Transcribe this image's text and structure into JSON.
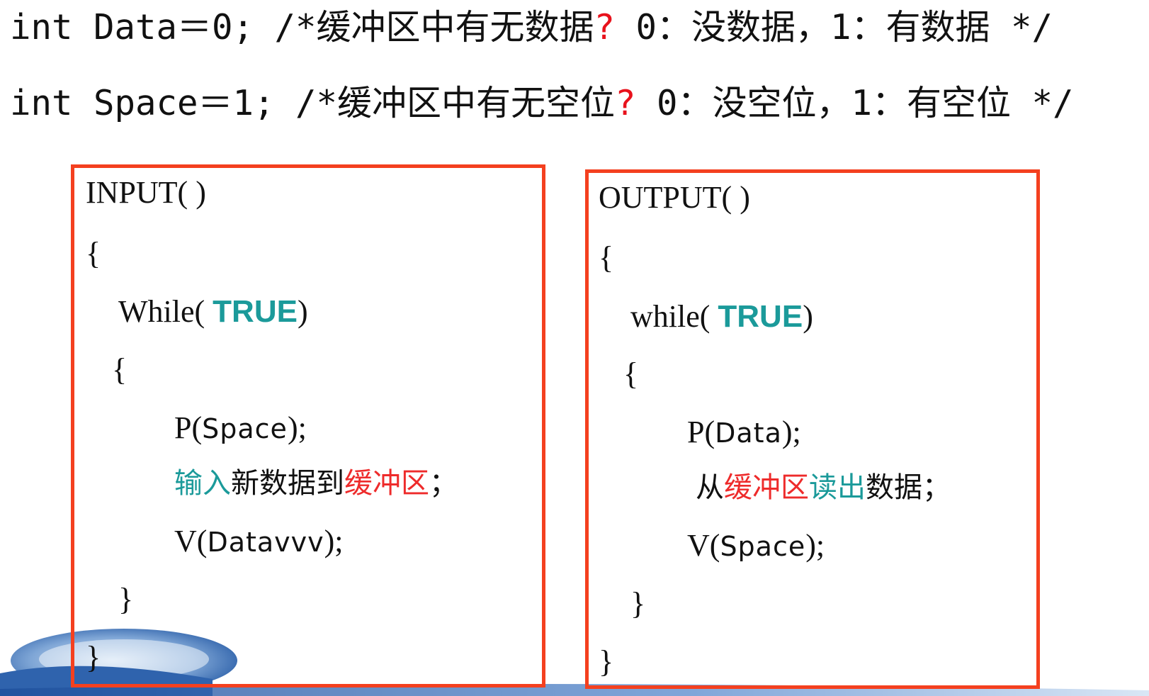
{
  "declarations": {
    "data_line": {
      "code": "int Data＝0;  ",
      "comment_start": "/*缓冲区中有无数据",
      "question": "?",
      "comment_end": " 0：没数据，1：有数据 */"
    },
    "space_line": {
      "code": "int Space＝1; ",
      "comment_start": "/*缓冲区中有无空位",
      "question": "?",
      "comment_end": " 0：没空位，1：有空位 */"
    }
  },
  "input_proc": {
    "header": "INPUT( )",
    "open_brace": "{",
    "loop_keyword": "While(",
    "loop_condition": "TRUE",
    "loop_close_paren": ")",
    "loop_open_brace": "{",
    "p_call": "P(",
    "p_arg": "Space",
    "p_end": ");",
    "action_part1": "输入",
    "action_part2": "新数据到",
    "action_part3": "缓冲区",
    "action_end": "；",
    "v_call": "V(",
    "v_arg": "Datavvv",
    "v_end": ");",
    "loop_close_brace": "}",
    "close_brace": "}"
  },
  "output_proc": {
    "header": "OUTPUT( )",
    "open_brace": "{",
    "loop_keyword": "while(",
    "loop_condition": "TRUE",
    "loop_close_paren": ")",
    "loop_open_brace": "{",
    "p_call": "P(",
    "p_arg": "Data",
    "p_end": ");",
    "action_part1": "从",
    "action_part2": "缓冲区",
    "action_part3": "读出",
    "action_part4": "数据",
    "action_end": "；",
    "v_call": "V(",
    "v_arg": "Space",
    "v_end": ");",
    "loop_close_brace": "}",
    "close_brace": "}"
  },
  "colors": {
    "box_border": "#f4401f",
    "keyword": "#1b9a9a",
    "highlight_red": "#ee2b2b",
    "question_mark": "#e8121c"
  }
}
